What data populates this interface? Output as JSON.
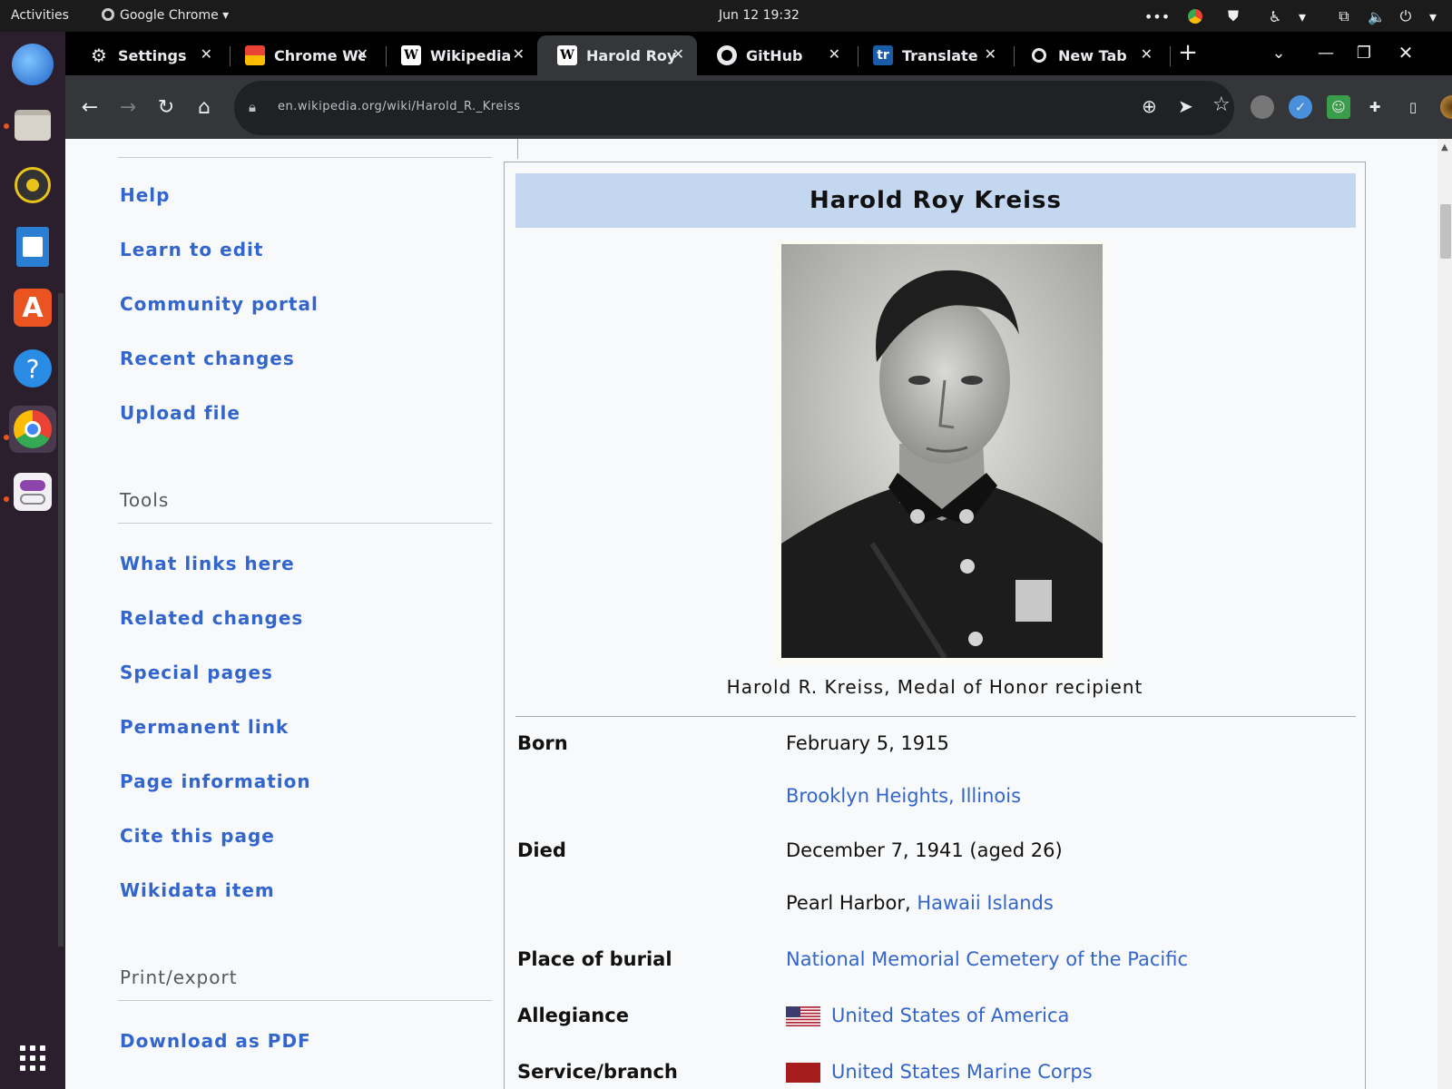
{
  "system": {
    "activities": "Activities",
    "app_menu": "Google Chrome",
    "clock": "Jun 12  19:32"
  },
  "tabs": [
    {
      "favicon": "gear-icon",
      "title": "Settings",
      "active": false
    },
    {
      "favicon": "store-icon",
      "title": "Chrome Web Store",
      "active": false
    },
    {
      "favicon": "W",
      "title": "Wikipedia",
      "active": false
    },
    {
      "favicon": "W",
      "title": "Harold Roy Kreiss",
      "active": true
    },
    {
      "favicon": "github-icon",
      "title": "GitHub",
      "active": false
    },
    {
      "favicon": "tr",
      "title": "Translate",
      "active": false
    },
    {
      "favicon": "chrome-icon",
      "title": "New Tab",
      "active": false
    }
  ],
  "address_bar": {
    "url": "en.wikipedia.org/wiki/Harold_R._Kreiss"
  },
  "sidebar": {
    "groups": [
      {
        "heading": "",
        "links": [
          "Help",
          "Learn to edit",
          "Community portal",
          "Recent changes",
          "Upload file"
        ]
      },
      {
        "heading": "Tools",
        "links": [
          "What links here",
          "Related changes",
          "Special pages",
          "Permanent link",
          "Page information",
          "Cite this page",
          "Wikidata item"
        ]
      },
      {
        "heading": "Print/export",
        "links": [
          "Download as PDF"
        ]
      }
    ]
  },
  "infobox": {
    "title": "Harold Roy Kreiss",
    "caption": "Harold R. Kreiss, Medal of Honor recipient",
    "rows": [
      {
        "label": "Born",
        "value": "February 5, 1915",
        "value_link": false
      },
      {
        "label": "",
        "value": "Brooklyn Heights, Illinois",
        "value_link": true
      },
      {
        "label": "Died",
        "value": "December 7, 1941 (aged 26)",
        "value_link": false
      },
      {
        "label": "",
        "value_plain": "Pearl Harbor,",
        "value": "Hawaii Islands",
        "value_link": true
      },
      {
        "label": "Place of burial",
        "value": "National Memorial Cemetery of the Pacific",
        "value_link": true
      },
      {
        "label": "Allegiance",
        "value": "United States of America",
        "value_link": true,
        "flag": "us"
      },
      {
        "label": "Service/branch",
        "value": "United States Marine Corps",
        "value_link": true,
        "flag": "usmc"
      }
    ]
  },
  "colors": {
    "link": "#3366cc",
    "infobox_header": "#c4d7f0",
    "ubuntu_accent": "#e95420"
  }
}
